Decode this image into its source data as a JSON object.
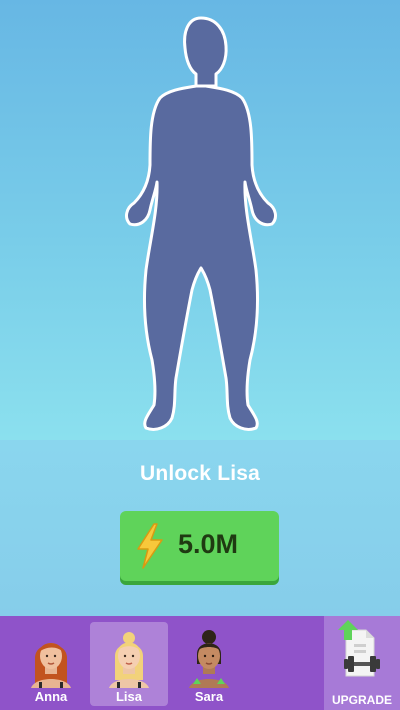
{
  "unlock": {
    "title": "Unlock Lisa",
    "price": "5.0M",
    "currency_icon": "lightning-bolt-icon"
  },
  "characters": [
    {
      "name": "Anna",
      "hair_color": "#c2531f",
      "selected": false
    },
    {
      "name": "Lisa",
      "hair_color": "#f2d27a",
      "selected": true
    },
    {
      "name": "Sara",
      "hair_color": "#2e2418",
      "selected": false
    }
  ],
  "upgrade": {
    "label": "UPGRADE",
    "icon": "dumbbell-upgrade-icon"
  },
  "colors": {
    "silhouette": "#596a9f",
    "button_green": "#5fd35a",
    "bottom_bar": "#8f53c9",
    "upgrade_tile": "#a77ad7"
  }
}
